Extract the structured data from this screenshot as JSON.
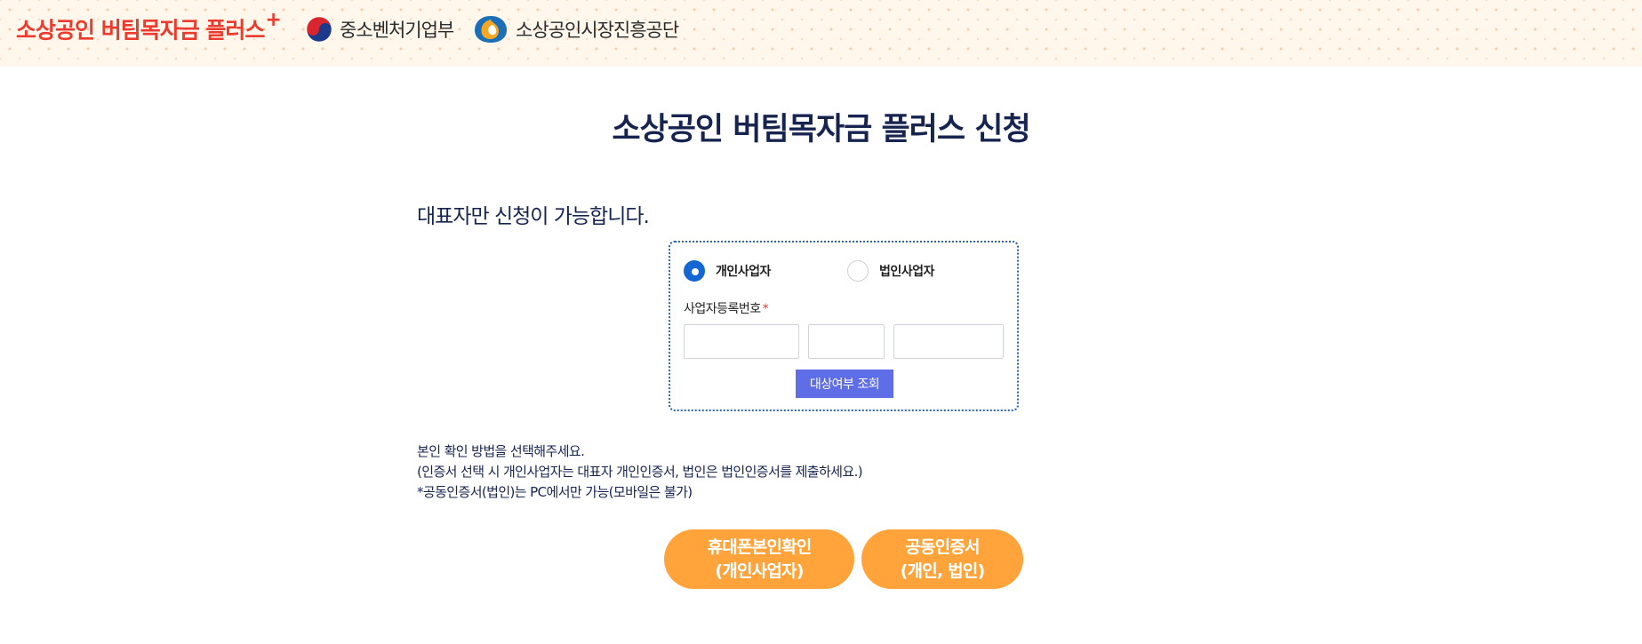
{
  "header": {
    "brand": "소상공인 버팀목자금 플러스",
    "brand_plus": "+",
    "ministry": "중소벤처기업부",
    "agency": "소상공인시장진흥공단"
  },
  "title": "소상공인 버팀목자금 플러스 신청",
  "notice": "대표자만 신청이 가능합니다.",
  "form": {
    "radio_options": [
      {
        "label": "개인사업자",
        "checked": true
      },
      {
        "label": "법인사업자",
        "checked": false
      }
    ],
    "field_label": "사업자등록번호",
    "required_mark": "*",
    "inputs": [
      "",
      "",
      ""
    ],
    "lookup_button": "대상여부 조회"
  },
  "instructions": [
    "본인 확인 방법을 선택해주세요.",
    "(인증서 선택 시 개인사업자는 대표자 개인인증서, 법인은 법인인증서를 제출하세요.)",
    "*공동인증서(법인)는 PC에서만 가능(모바일은 불가)"
  ],
  "auth_buttons": {
    "phone": {
      "line1": "휴대폰본인확인",
      "line2": "(개인사업자)"
    },
    "cert": {
      "line1": "공동인증서",
      "line2": "(개인, 법인)"
    }
  },
  "colors": {
    "brand_red": "#ec3b2e",
    "navy": "#17244f",
    "radio_blue": "#1467d3",
    "lookup_button": "#5f6de6",
    "auth_orange": "#ffa33a",
    "header_bg": "#fff6ec"
  }
}
